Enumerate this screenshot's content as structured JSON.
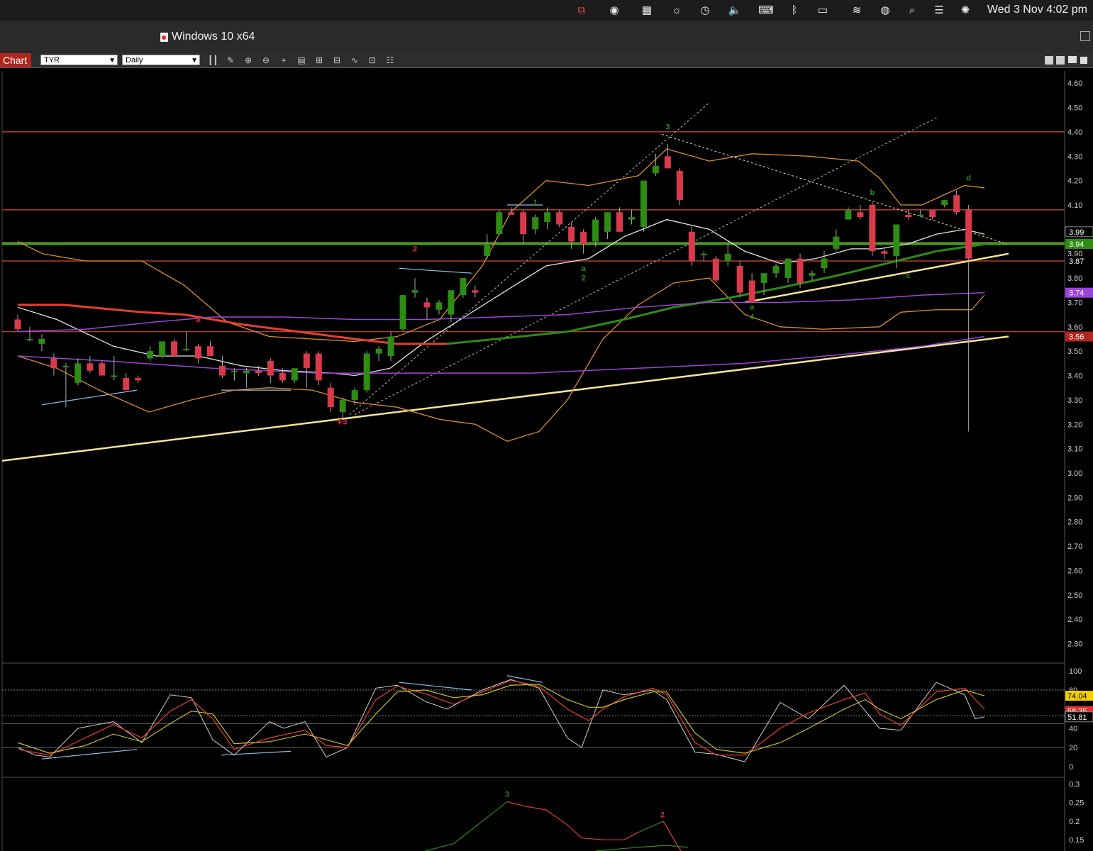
{
  "menubar": {
    "clock": "Wed 3 Nov  4:02 pm",
    "icons": [
      "parallels-icon",
      "screen-share-icon",
      "window-manager-icon",
      "brightness-icon",
      "time-machine-icon",
      "volume-icon",
      "input-source-icon",
      "bluetooth-icon",
      "battery-icon",
      "wifi-icon",
      "user-icon",
      "search-icon",
      "control-center-icon",
      "siri-icon"
    ]
  },
  "window": {
    "title": "Windows 10 x64"
  },
  "toolbar": {
    "chart_label": "Chart",
    "symbol": "TYR",
    "interval": "Daily",
    "tools": [
      "bar-type-icon",
      "draw-tool-icon",
      "zoom-in-icon",
      "zoom-out-icon",
      "crosshair-icon",
      "properties-icon",
      "indicators-icon",
      "studies-icon",
      "drawings-icon",
      "template-icon",
      "list-icon"
    ]
  },
  "chart_data": {
    "type": "candlestick",
    "symbol": "TYR",
    "interval": "Daily",
    "y_ticks": [
      "4.60",
      "4.50",
      "4.40",
      "4.30",
      "4.20",
      "4.10",
      "3.90",
      "3.80",
      "3.70",
      "3.60",
      "3.50",
      "3.40",
      "3.30",
      "3.20",
      "3.10",
      "3.00",
      "2.90",
      "2.80",
      "2.70",
      "2.60",
      "2.50",
      "2.40",
      "2.30"
    ],
    "ylim": [
      2.22,
      4.65
    ],
    "price_markers": [
      {
        "value": "3.99",
        "bg": "#000000",
        "fg": "#ffffff",
        "border": "#888888"
      },
      {
        "value": "3.94",
        "bg": "#2e8b14",
        "fg": "#ffffff"
      },
      {
        "value": "3.87",
        "bg": "#000000",
        "fg": "#ffffff"
      },
      {
        "value": "3.74",
        "bg": "#9b45d8",
        "fg": "#ffffff"
      },
      {
        "value": "3.56",
        "bg": "#b0261e",
        "fg": "#ffffff"
      }
    ],
    "horizontal_levels": [
      4.4,
      4.08,
      3.87,
      3.58
    ],
    "green_level": 3.94,
    "candles": [
      [
        3.63,
        3.65,
        3.58,
        3.59
      ],
      [
        3.55,
        3.6,
        3.54,
        3.55
      ],
      [
        3.53,
        3.57,
        3.5,
        3.55
      ],
      [
        3.47,
        3.49,
        3.4,
        3.43
      ],
      [
        3.44,
        3.45,
        3.27,
        3.44
      ],
      [
        3.37,
        3.47,
        3.36,
        3.45
      ],
      [
        3.45,
        3.48,
        3.41,
        3.42
      ],
      [
        3.45,
        3.46,
        3.4,
        3.4
      ],
      [
        3.4,
        3.48,
        3.38,
        3.4
      ],
      [
        3.39,
        3.41,
        3.35,
        3.34
      ],
      [
        3.39,
        3.4,
        3.37,
        3.38
      ],
      [
        3.47,
        3.52,
        3.46,
        3.5
      ],
      [
        3.48,
        3.54,
        3.47,
        3.54
      ],
      [
        3.54,
        3.55,
        3.48,
        3.48
      ],
      [
        3.51,
        3.58,
        3.5,
        3.51
      ],
      [
        3.52,
        3.53,
        3.45,
        3.47
      ],
      [
        3.52,
        3.54,
        3.48,
        3.48
      ],
      [
        3.44,
        3.48,
        3.39,
        3.4
      ],
      [
        3.42,
        3.43,
        3.38,
        3.42
      ],
      [
        3.41,
        3.43,
        3.35,
        3.42
      ],
      [
        3.42,
        3.44,
        3.4,
        3.41
      ],
      [
        3.46,
        3.47,
        3.37,
        3.4
      ],
      [
        3.41,
        3.43,
        3.37,
        3.38
      ],
      [
        3.38,
        3.42,
        3.37,
        3.43
      ],
      [
        3.49,
        3.5,
        3.35,
        3.43
      ],
      [
        3.49,
        3.5,
        3.36,
        3.38
      ],
      [
        3.35,
        3.37,
        3.25,
        3.27
      ],
      [
        3.25,
        3.31,
        3.22,
        3.3
      ],
      [
        3.3,
        3.35,
        3.28,
        3.34
      ],
      [
        3.34,
        3.5,
        3.33,
        3.49
      ],
      [
        3.49,
        3.52,
        3.46,
        3.51
      ],
      [
        3.48,
        3.58,
        3.46,
        3.56
      ],
      [
        3.59,
        3.73,
        3.58,
        3.73
      ],
      [
        3.74,
        3.8,
        3.72,
        3.75
      ],
      [
        3.7,
        3.72,
        3.63,
        3.68
      ],
      [
        3.67,
        3.71,
        3.65,
        3.7
      ],
      [
        3.65,
        3.74,
        3.62,
        3.75
      ],
      [
        3.73,
        3.8,
        3.72,
        3.8
      ],
      [
        3.75,
        3.77,
        3.72,
        3.74
      ],
      [
        3.89,
        3.98,
        3.88,
        3.94
      ],
      [
        3.98,
        4.08,
        3.98,
        4.07
      ],
      [
        4.07,
        4.09,
        4.06,
        4.06
      ],
      [
        4.07,
        4.08,
        3.94,
        3.98
      ],
      [
        4.0,
        4.06,
        3.98,
        4.05
      ],
      [
        4.03,
        4.09,
        4.0,
        4.07
      ],
      [
        4.07,
        4.08,
        4.01,
        4.02
      ],
      [
        4.01,
        4.03,
        3.92,
        3.95
      ],
      [
        3.99,
        4.0,
        3.9,
        3.94
      ],
      [
        3.95,
        4.05,
        3.93,
        4.04
      ],
      [
        3.99,
        4.07,
        3.96,
        4.07
      ],
      [
        4.07,
        4.09,
        3.99,
        3.99
      ],
      [
        4.04,
        4.08,
        4.02,
        4.05
      ],
      [
        4.01,
        4.2,
        3.99,
        4.2
      ],
      [
        4.23,
        4.31,
        4.22,
        4.26
      ],
      [
        4.3,
        4.35,
        4.25,
        4.25
      ],
      [
        4.24,
        4.25,
        4.1,
        4.12
      ],
      [
        3.99,
        4.01,
        3.85,
        3.87
      ],
      [
        3.9,
        3.91,
        3.87,
        3.9
      ],
      [
        3.88,
        3.89,
        3.78,
        3.79
      ],
      [
        3.87,
        3.94,
        3.85,
        3.9
      ],
      [
        3.85,
        3.87,
        3.72,
        3.74
      ],
      [
        3.79,
        3.82,
        3.7,
        3.7
      ],
      [
        3.78,
        3.8,
        3.73,
        3.82
      ],
      [
        3.82,
        3.86,
        3.8,
        3.85
      ],
      [
        3.8,
        3.88,
        3.78,
        3.88
      ],
      [
        3.88,
        3.9,
        3.76,
        3.78
      ],
      [
        3.81,
        3.83,
        3.79,
        3.82
      ],
      [
        3.84,
        3.91,
        3.82,
        3.88
      ],
      [
        3.92,
        4.0,
        3.91,
        3.97
      ],
      [
        4.04,
        4.09,
        4.04,
        4.08
      ],
      [
        4.07,
        4.1,
        4.04,
        4.05
      ],
      [
        4.1,
        4.11,
        3.89,
        3.91
      ],
      [
        3.91,
        3.92,
        3.88,
        3.9
      ],
      [
        3.89,
        3.95,
        3.84,
        4.02
      ],
      [
        4.06,
        4.08,
        4.04,
        4.05
      ],
      [
        4.06,
        4.08,
        4.05,
        4.06
      ],
      [
        4.08,
        4.07,
        4.04,
        4.05
      ],
      [
        4.1,
        4.12,
        4.09,
        4.12
      ],
      [
        4.14,
        4.16,
        4.06,
        4.07
      ],
      [
        4.08,
        4.1,
        3.17,
        3.88
      ]
    ],
    "annotations": [
      {
        "label": "a",
        "color": "#e03030",
        "i": 15,
        "y": 3.62
      },
      {
        "label": "2",
        "color": "#e03030",
        "i": 33,
        "y": 3.91
      },
      {
        "label": "F3",
        "color": "#e03030",
        "i": 27,
        "y": 3.2
      },
      {
        "label": "1",
        "color": "#2e8b14",
        "i": 43,
        "y": 4.1
      },
      {
        "label": "a",
        "color": "#2e8b14",
        "i": 47,
        "y": 3.83
      },
      {
        "label": "2",
        "color": "#2e8b14",
        "i": 47,
        "y": 3.79
      },
      {
        "label": "3",
        "color": "#2e8b14",
        "i": 54,
        "y": 4.41
      },
      {
        "label": "a",
        "color": "#2e8b14",
        "i": 61,
        "y": 3.67
      },
      {
        "label": "4",
        "color": "#2e8b14",
        "i": 61,
        "y": 3.63
      },
      {
        "label": "b",
        "color": "#2e8b14",
        "i": 71,
        "y": 4.14
      },
      {
        "label": "c",
        "color": "#2e8b14",
        "i": 74,
        "y": 3.8
      },
      {
        "label": "d",
        "color": "#2e8b14",
        "i": 79,
        "y": 4.2
      }
    ],
    "stochastic": {
      "y_ticks": [
        "100",
        "80",
        "60",
        "40",
        "20",
        "0"
      ],
      "markers": [
        {
          "value": "74.04",
          "bg": "#f5d000",
          "fg": "#000000"
        },
        {
          "value": "58.35",
          "bg": "#e03030",
          "fg": "#ffffff"
        },
        {
          "value": "51.81",
          "bg": "#000000",
          "fg": "#ffffff",
          "border": "#888888"
        }
      ]
    },
    "lower_panel": {
      "y_ticks": [
        "0.3",
        "0.25",
        "0.2",
        "0.15"
      ],
      "annotations": [
        {
          "label": "3",
          "color": "#2e8b14"
        },
        {
          "label": "2",
          "color": "#e03030"
        }
      ]
    }
  }
}
